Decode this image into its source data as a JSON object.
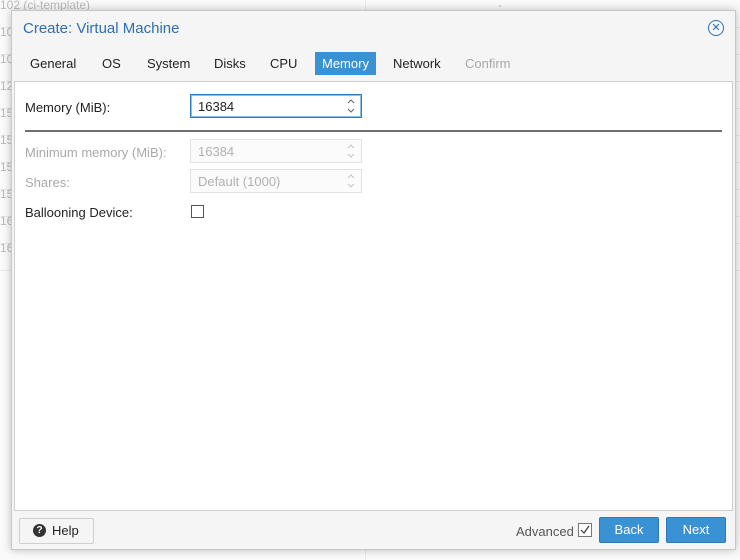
{
  "background": {
    "rows": [
      {
        "col1": "102 (ci-template)",
        "col2": "-"
      },
      {
        "col1": "10",
        "col2": ""
      },
      {
        "col1": "10",
        "col2": ""
      },
      {
        "col1": "12",
        "col2": ""
      },
      {
        "col1": "15",
        "col2": ""
      },
      {
        "col1": "15",
        "col2": ""
      },
      {
        "col1": "15",
        "col2": ""
      },
      {
        "col1": "15",
        "col2": ""
      },
      {
        "col1": "16",
        "col2": ""
      },
      {
        "col1": "16",
        "col2": ""
      }
    ]
  },
  "dialog": {
    "title": "Create: Virtual Machine",
    "close_icon": "close-icon",
    "tabs": [
      {
        "label": "General",
        "state": "normal"
      },
      {
        "label": "OS",
        "state": "normal"
      },
      {
        "label": "System",
        "state": "normal"
      },
      {
        "label": "Disks",
        "state": "normal"
      },
      {
        "label": "CPU",
        "state": "normal"
      },
      {
        "label": "Memory",
        "state": "active"
      },
      {
        "label": "Network",
        "state": "normal"
      },
      {
        "label": "Confirm",
        "state": "disabled"
      }
    ],
    "form": {
      "memory_label": "Memory (MiB):",
      "memory_value": "16384",
      "min_memory_label": "Minimum memory (MiB):",
      "min_memory_value": "16384",
      "shares_label": "Shares:",
      "shares_value": "Default (1000)",
      "ballooning_label": "Ballooning Device:",
      "ballooning_checked": false
    },
    "footer": {
      "help_label": "Help",
      "advanced_label": "Advanced",
      "advanced_checked": true,
      "back_label": "Back",
      "next_label": "Next"
    }
  },
  "colors": {
    "accent": "#3892d3",
    "title": "#2b6fb3"
  }
}
